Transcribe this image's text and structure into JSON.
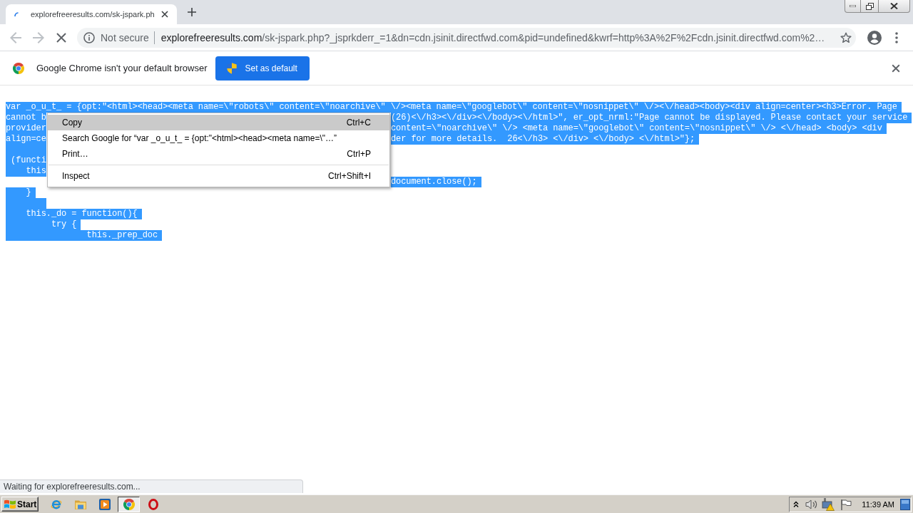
{
  "tabs": [
    {
      "title": "explorefreeresults.com/sk-jspark.ph",
      "selected": true,
      "loading": true
    }
  ],
  "toolbar": {
    "back": {
      "disabled": true
    },
    "forward": {
      "disabled": true
    },
    "loading": true,
    "security": "Not secure",
    "url": {
      "host": "explorefreeresults.com",
      "path": "/sk-jspark.php?_jsprkderr_=1&dn=cdn.jsinit.directfwd.com&pid=undefined&kwrf=http%3A%2F%2Fcdn.jsinit.directfwd.com%2…"
    }
  },
  "infobar": {
    "message": "Google Chrome isn't your default browser",
    "button": "Set as default"
  },
  "page": {
    "selected": true,
    "lines": [
      {
        "kind": "full",
        "text": "var _o_u_t_ = {opt:\"<html><head><meta name=\\\"robots\\\" content=\\\"noarchive\\\" \\/><meta name=\\\"googlebot\\\" content=\\\"nosnippet\\\" \\/><\\/head><body><div align=center><h3>Error. Page"
      },
      {
        "kind": "split",
        "start": "cannot b",
        "end": "(26)<\\/h3><\\/div><\\/body><\\/html>\", er_opt_nrml:\"Page cannot be displayed. Please contact your service"
      },
      {
        "kind": "split",
        "start": "provider",
        "end": "content=\\\"noarchive\\\" \\/> <meta name=\\\"googlebot\\\" content=\\\"nosnippet\\\" \\/> <\\/head> <body> <div"
      },
      {
        "kind": "split",
        "start": "align=ce",
        "end": "der for more details.  26<\\/h3> <\\/div> <\\/body> <\\/html>\"};"
      },
      {
        "kind": "blank"
      },
      {
        "kind": "split",
        "start": " (functi"
      },
      {
        "kind": "split",
        "start": "    this"
      },
      {
        "kind": "split",
        "end": "document.close();"
      },
      {
        "kind": "full",
        "text": "    }"
      },
      {
        "kind": "blank"
      },
      {
        "kind": "full",
        "text": "    this._do = function(){"
      },
      {
        "kind": "full",
        "text": "         try {"
      },
      {
        "kind": "full",
        "text": "                this._prep_doc"
      }
    ]
  },
  "context_menu": {
    "items": [
      {
        "kind": "item",
        "label": "Copy",
        "shortcut": "Ctrl+C",
        "selected": true
      },
      {
        "kind": "item",
        "label": "Search Google for “var _o_u_t_ = {opt:\"<html><head><meta name=\\\"…”",
        "selected": false
      },
      {
        "kind": "item",
        "label": "Print…",
        "shortcut": "Ctrl+P",
        "selected": false
      },
      {
        "kind": "separator"
      },
      {
        "kind": "item",
        "label": "Inspect",
        "shortcut": "Ctrl+Shift+I",
        "selected": false
      }
    ]
  },
  "status_bubble": {
    "text": "Waiting for explorefreeresults.com..."
  },
  "taskbar": {
    "start": "Start",
    "apps": [
      {
        "kind": "ie",
        "selected": false
      },
      {
        "kind": "explorer",
        "selected": false
      },
      {
        "kind": "mediaplayer",
        "selected": false
      },
      {
        "kind": "chrome",
        "selected": true
      },
      {
        "kind": "opera",
        "selected": false
      }
    ],
    "clock": "11:39 AM"
  }
}
